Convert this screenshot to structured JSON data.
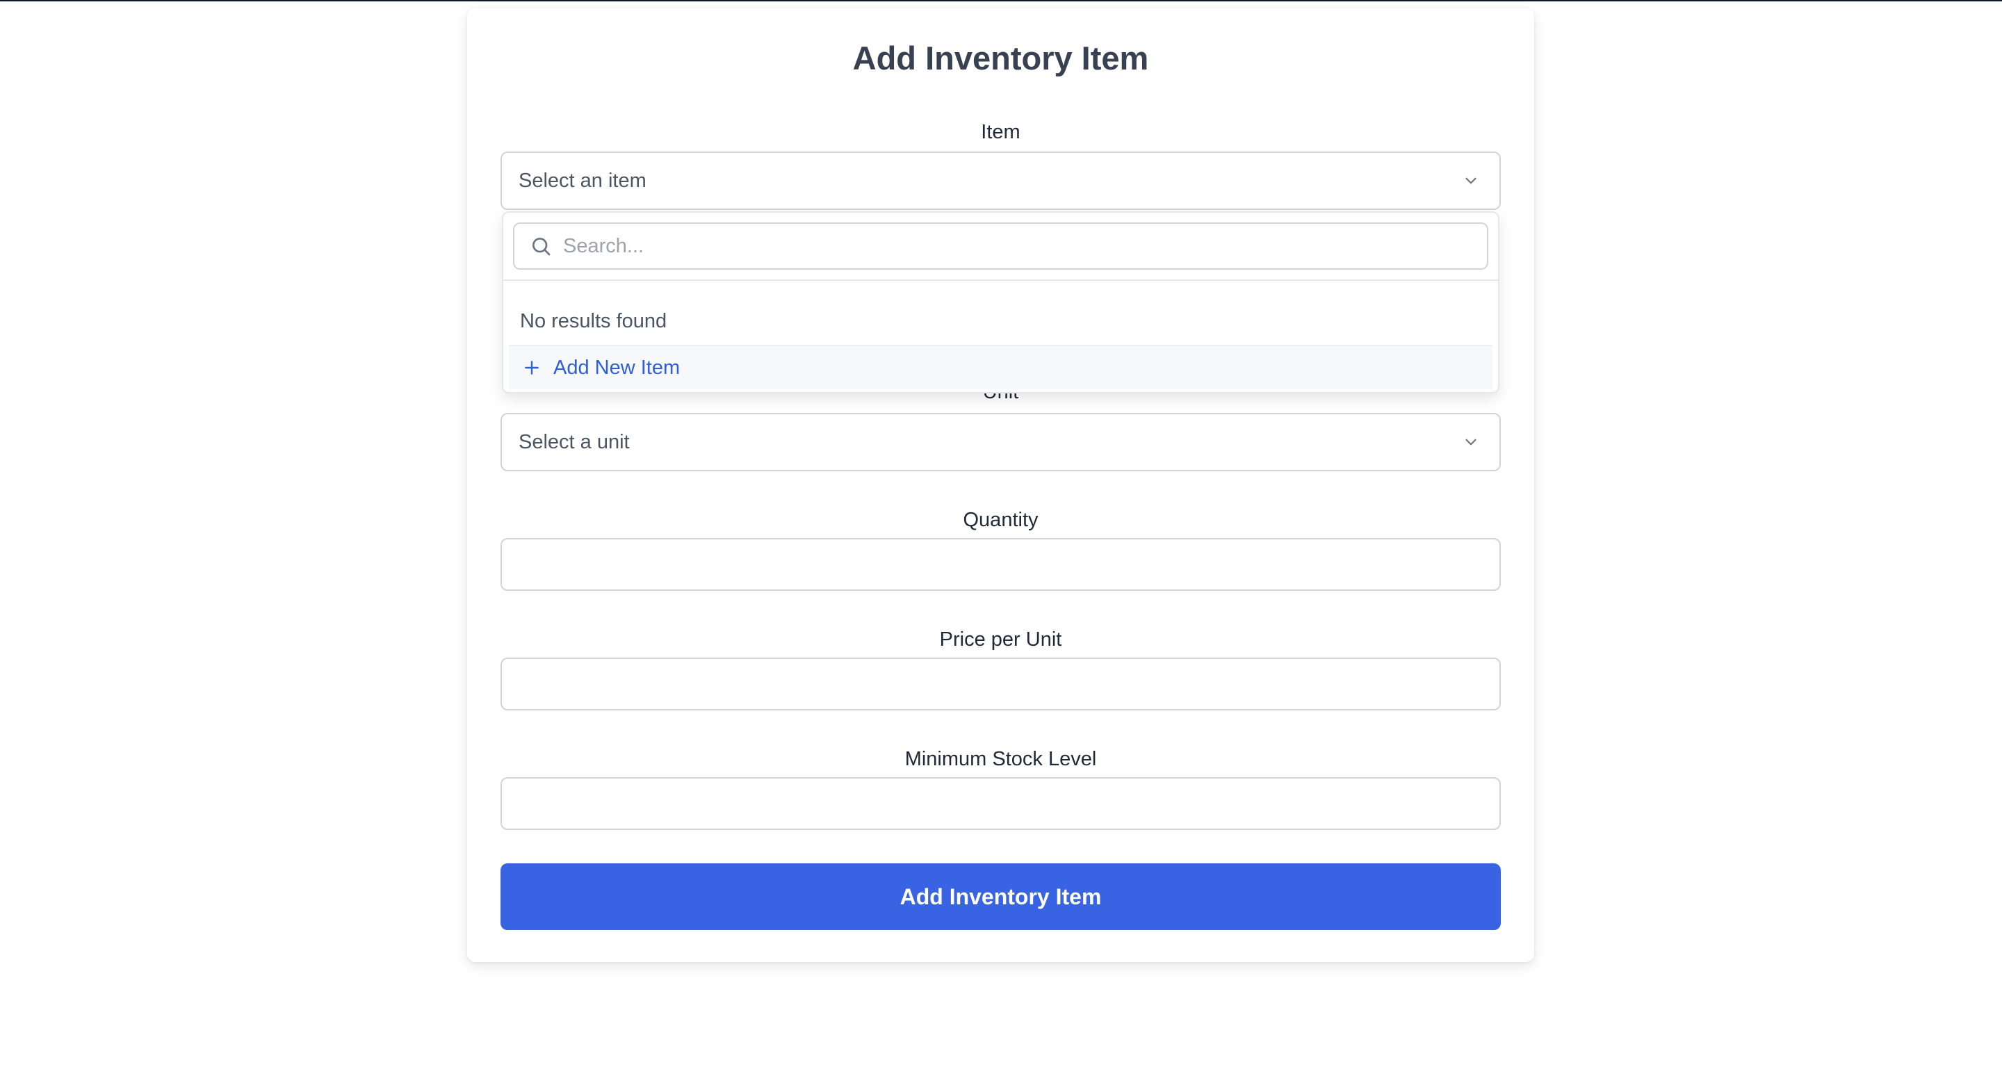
{
  "form": {
    "title": "Add Inventory Item",
    "item": {
      "label": "Item",
      "value": "Select an item",
      "dropdown": {
        "search_placeholder": "Search...",
        "search_value": "",
        "empty_text": "No results found",
        "add_new_label": "Add New Item"
      }
    },
    "unit": {
      "label": "Unit",
      "value": "Select a unit"
    },
    "quantity": {
      "label": "Quantity",
      "value": ""
    },
    "price_per_unit": {
      "label": "Price per Unit",
      "value": ""
    },
    "minimum_stock_level": {
      "label": "Minimum Stock Level",
      "value": ""
    },
    "submit_label": "Add Inventory Item"
  },
  "icons": {
    "select_chevron": "chevron-down-icon",
    "search": "search-icon",
    "add": "plus-icon"
  },
  "colors": {
    "primary": "#3863e3",
    "link": "#2f5ed8",
    "border": "#d1d5db",
    "text": "#374151"
  }
}
